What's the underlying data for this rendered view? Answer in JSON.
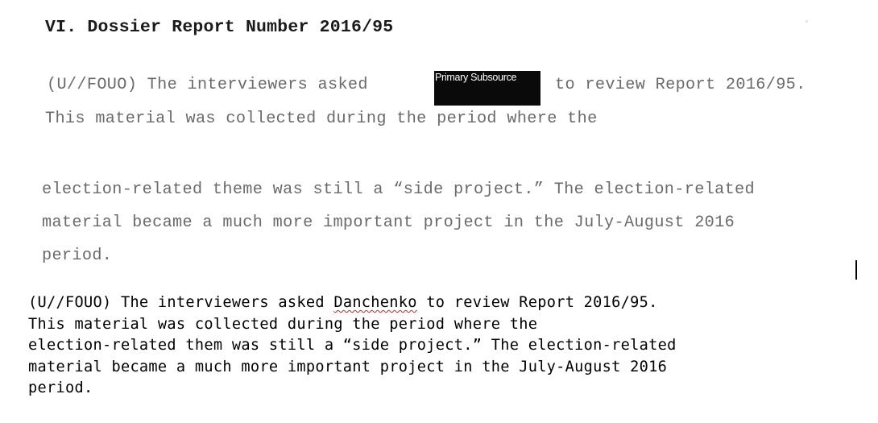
{
  "scanned_document": {
    "heading": "VI. Dossier Report Number 2016/95",
    "redaction": {
      "label": "Primary Subsource",
      "color": "#0a0a0a"
    },
    "lines": [
      "(U//FOUO) The interviewers asked",
      "to review Report 2016/95.",
      "This material was collected during the period where the",
      "election-related theme was still a “side project.” The election-related",
      "material became a much more important project in the July-August 2016",
      "period."
    ]
  },
  "transcription": {
    "line1_prefix": "(U//FOUO) The interviewers asked ",
    "line1_flagged_word": "Danchenko",
    "line1_suffix": " to review Report 2016/95.",
    "lines": [
      "This material was collected during the period where the",
      "election-related them was still a “side project.” The election-related",
      "material became a much more important project in the July-August 2016",
      "period."
    ],
    "spellcheck_color": "#d42020"
  }
}
